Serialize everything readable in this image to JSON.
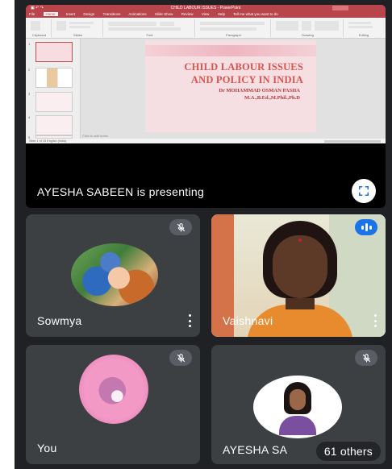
{
  "presentation": {
    "ppt_title_bar": "CHILD LABOUR ISSUES - PowerPoint",
    "ppt_tabs": [
      "File",
      "Home",
      "Insert",
      "Design",
      "Transitions",
      "Animations",
      "Slide Show",
      "Review",
      "View",
      "Help",
      "Tell me what you want to do"
    ],
    "ribbon_groups": [
      "Clipboard",
      "Slides",
      "Font",
      "Paragraph",
      "Drawing",
      "Editing"
    ],
    "slide": {
      "title_line1": "CHILD LABOUR ISSUES",
      "title_line2": "AND POLICY IN INDIA",
      "author": "Dr MOHAMMAD OSMAN PASHA",
      "degrees": "M.A.,B.Ed.,M.Phil.,Ph.D"
    },
    "notes_placeholder": "Click to add notes",
    "slide_numbers": [
      "1",
      "2",
      "3",
      "4",
      "5"
    ],
    "status_text": "Slide 1 of 15   English (India)",
    "presenting_label": "AYESHA SABEEN is presenting"
  },
  "participants": [
    {
      "name": "Sowmya",
      "muted": true
    },
    {
      "name": "Vaishnavi",
      "speaking": true
    },
    {
      "name": "You",
      "muted": true
    },
    {
      "name": "AYESHA SA",
      "muted": true
    }
  ],
  "others_count": "61 others",
  "colors": {
    "background": "#202124",
    "tile": "#3c4043",
    "speaking": "#1a73e8",
    "slide_title": "#d9534f"
  },
  "icons": [
    "fullscreen-icon",
    "mic-off-icon",
    "more-vert-icon",
    "speaking-icon"
  ]
}
